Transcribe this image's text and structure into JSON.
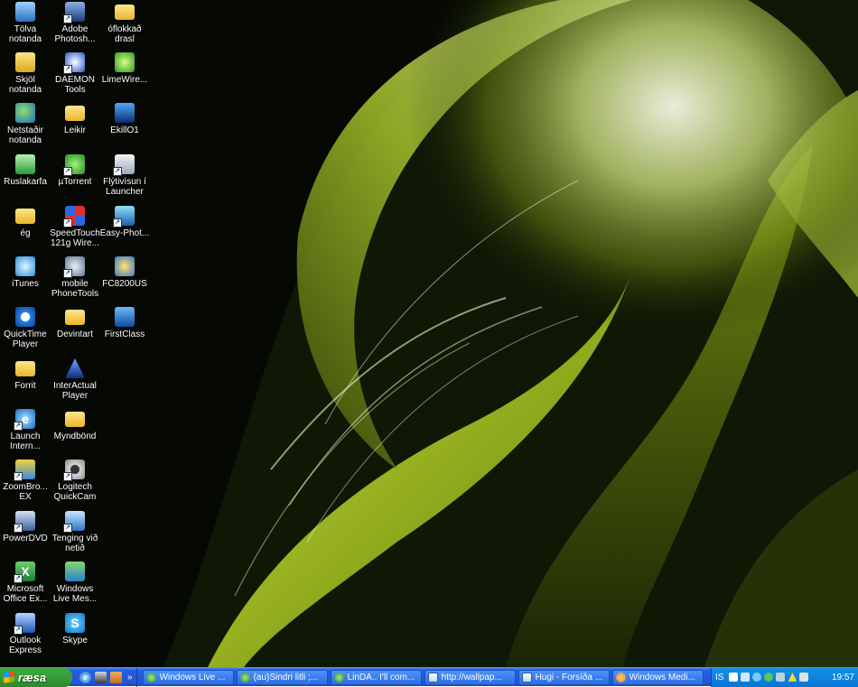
{
  "desktop": {
    "icons": [
      {
        "label": "Tölva notanda",
        "icon": "computer-icon"
      },
      {
        "label": "Skjöl notanda",
        "icon": "documents-folder-icon"
      },
      {
        "label": "Netstaðir notanda",
        "icon": "network-places-icon"
      },
      {
        "label": "Ruslakarfa",
        "icon": "recycle-bin-icon"
      },
      {
        "label": "ég",
        "icon": "folder-icon"
      },
      {
        "label": "iTunes",
        "icon": "itunes-icon"
      },
      {
        "label": "QuickTime Player",
        "icon": "quicktime-icon"
      },
      {
        "label": "Forrit",
        "icon": "folder-icon"
      },
      {
        "label": "Launch Intern...",
        "icon": "internet-explorer-icon"
      },
      {
        "label": "ZoomBro... EX",
        "icon": "zoombrowser-icon"
      },
      {
        "label": "PowerDVD",
        "icon": "powerdvd-icon"
      },
      {
        "label": "Microsoft Office Ex...",
        "icon": "excel-icon"
      },
      {
        "label": "Outlook Express",
        "icon": "outlook-express-icon"
      },
      {
        "label": "Adobe Photosh...",
        "icon": "photoshop-icon"
      },
      {
        "label": "DAEMON Tools",
        "icon": "daemon-tools-icon"
      },
      {
        "label": "Leikir",
        "icon": "folder-icon"
      },
      {
        "label": "µTorrent",
        "icon": "utorrent-icon"
      },
      {
        "label": "SpeedTouch 121g Wire...",
        "icon": "speedtouch-icon"
      },
      {
        "label": "mobile PhoneTools",
        "icon": "phonetools-icon"
      },
      {
        "label": "Devintart",
        "icon": "folder-icon"
      },
      {
        "label": "InterActual Player",
        "icon": "interactual-icon"
      },
      {
        "label": "Myndbönd",
        "icon": "folder-icon"
      },
      {
        "label": "Logitech QuickCam",
        "icon": "webcam-icon"
      },
      {
        "label": "Tenging við netið",
        "icon": "internet-connection-icon"
      },
      {
        "label": "Windows Live Mes...",
        "icon": "messenger-icon"
      },
      {
        "label": "Skype",
        "icon": "skype-icon"
      },
      {
        "label": "óflokkað drasl",
        "icon": "folder-icon"
      },
      {
        "label": "LimeWire...",
        "icon": "limewire-icon"
      },
      {
        "label": "EkillO1",
        "icon": "eskill-icon"
      },
      {
        "label": "Flýtivísun í Launcher",
        "icon": "launcher-shortcut-icon"
      },
      {
        "label": "Easy-Phot...",
        "icon": "easy-photo-icon"
      },
      {
        "label": "FC8200US",
        "icon": "fc8200-icon"
      },
      {
        "label": "FirstClass",
        "icon": "firstclass-icon"
      }
    ]
  },
  "taskbar": {
    "start_label": "ræsa",
    "quick_launch": [
      {
        "icon": "ie-icon",
        "color": "#2d7ce0"
      },
      {
        "icon": "desktop-icon",
        "color": "#3a3a3a"
      },
      {
        "icon": "media-icon",
        "color": "#c46d1c"
      }
    ],
    "quick_launch_more": "»",
    "tasks": [
      {
        "label": "Windows Live ...",
        "icon": "messenger-icon",
        "color": "#5cc45c"
      },
      {
        "label": "(au)Sindri litli ;...",
        "icon": "messenger-icon",
        "color": "#5cc45c"
      },
      {
        "label": "LinDA.. I'll com...",
        "icon": "messenger-icon",
        "color": "#5cc45c"
      },
      {
        "label": "http://wallpap...",
        "icon": "ie-icon",
        "color": "#2d7ce0"
      },
      {
        "label": "Hugi - Forsíða ...",
        "icon": "ie-icon",
        "color": "#2d7ce0"
      },
      {
        "label": "Windows Medi...",
        "icon": "media-player-icon",
        "color": "#e87b1e"
      }
    ],
    "tray": {
      "language": "IS",
      "clock": "19:57",
      "icons": [
        {
          "icon": "help-icon",
          "color": "#ffffff"
        },
        {
          "icon": "network-icon",
          "color": "#d0e8ff"
        },
        {
          "icon": "quicktime-tray-icon",
          "color": "#7cc8ff"
        },
        {
          "icon": "messenger-tray-icon",
          "color": "#59c659"
        },
        {
          "icon": "monitor-tray-icon",
          "color": "#c0d0e0"
        },
        {
          "icon": "warning-tray-icon",
          "color": "#ffd23a"
        },
        {
          "icon": "volume-icon",
          "color": "#e0e0e0"
        }
      ]
    }
  }
}
